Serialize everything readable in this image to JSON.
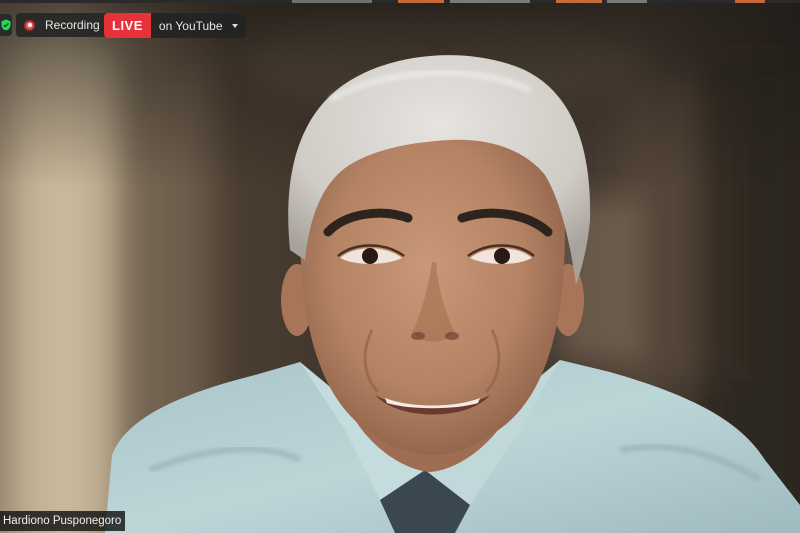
{
  "recording": {
    "label": "Recording",
    "icon": "record-dot-icon"
  },
  "live": {
    "badge": "LIVE",
    "destination": "on YouTube",
    "dropdown_icon": "chevron-down-icon",
    "badge_color": "#e8323a"
  },
  "security": {
    "icon": "shield-check-icon",
    "color": "#23d959"
  },
  "participant": {
    "name": "Hardiono Pusponegoro"
  }
}
